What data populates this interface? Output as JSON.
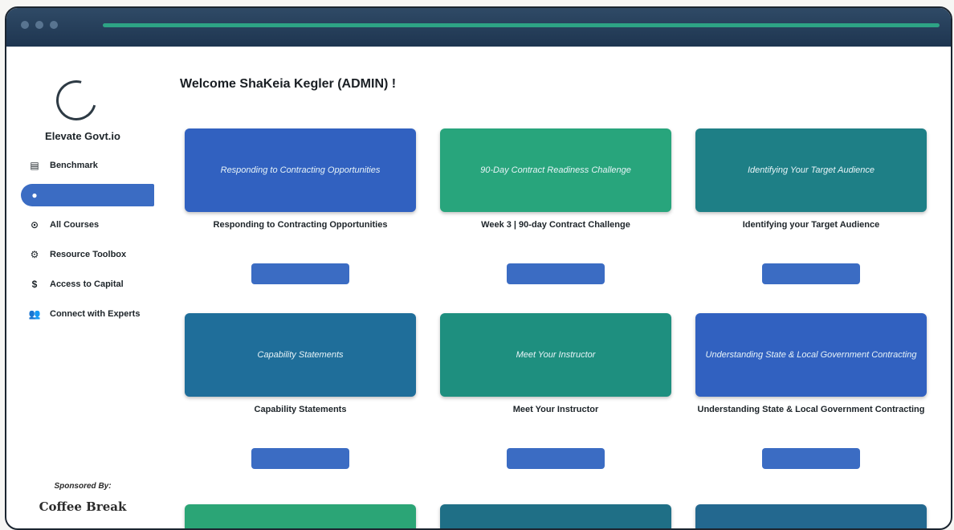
{
  "sidebar": {
    "brand": "Elevate Govt.io",
    "items": [
      {
        "label": "Benchmark",
        "icon": "clipboard-icon",
        "glyph": "▤",
        "active": false
      },
      {
        "label": "",
        "icon": "info-icon",
        "glyph": "●",
        "active": true
      },
      {
        "label": "All Courses",
        "icon": "play-circle-icon",
        "glyph": "⊙",
        "active": false
      },
      {
        "label": "Resource Toolbox",
        "icon": "gear-icon",
        "glyph": "⚙",
        "active": false
      },
      {
        "label": "Access to Capital",
        "icon": "dollar-icon",
        "glyph": "$",
        "active": false
      },
      {
        "label": "Connect with Experts",
        "icon": "users-icon",
        "glyph": "👥",
        "active": false
      }
    ],
    "sponsored_label": "Sponsored By:",
    "sponsor_name": "Coffee Break"
  },
  "main": {
    "welcome": "Welcome ShaKeia Kegler (ADMIN) !",
    "courses": [
      {
        "thumb_text": "Responding to Contracting Opportunities",
        "title": "Responding to Contracting Opportunities",
        "desc": "",
        "button": "",
        "color": "#3161c0"
      },
      {
        "thumb_text": "90-Day Contract Readiness Challenge",
        "title": "Week 3 | 90-day Contract Challenge",
        "desc": "",
        "button": "",
        "color": "#28a57c"
      },
      {
        "thumb_text": "Identifying Your Target Audience",
        "title": "Identifying your Target Audience",
        "desc": "",
        "button": "",
        "color": "#1e7f86"
      },
      {
        "thumb_text": "Capability Statements",
        "title": "Capability Statements",
        "desc": "",
        "button": "",
        "color": "#1f6e9a"
      },
      {
        "thumb_text": "Meet Your Instructor",
        "title": "Meet Your Instructor",
        "desc": "",
        "button": "",
        "color": "#1e8f7f"
      },
      {
        "thumb_text": "Understanding State & Local Government Contracting",
        "title": "Understanding State & Local Government Contracting",
        "desc": "",
        "button": "",
        "color": "#3161c0"
      },
      {
        "thumb_text": "",
        "title": "",
        "desc": "",
        "button": "",
        "color": "#2ba576"
      },
      {
        "thumb_text": "",
        "title": "",
        "desc": "",
        "button": "",
        "color": "#1f6f86"
      },
      {
        "thumb_text": "",
        "title": "",
        "desc": "",
        "button": "",
        "color": "#23688f"
      }
    ]
  },
  "colors": {
    "accent": "#3b6cc3",
    "titlebar": "#1e3550"
  }
}
